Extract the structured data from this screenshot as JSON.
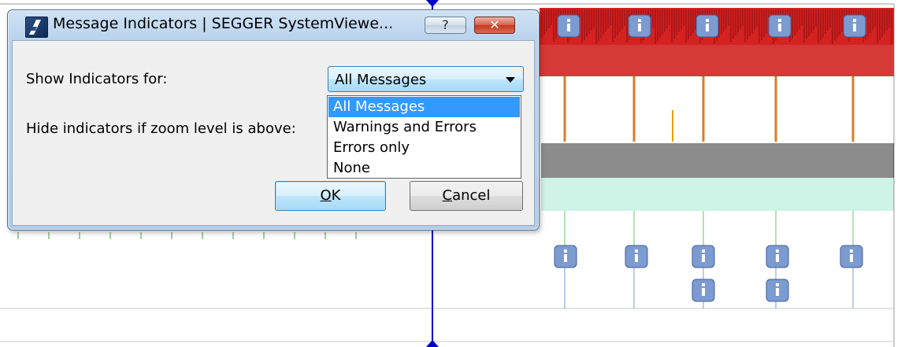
{
  "dialog": {
    "title": "Message Indicators | SEGGER SystemViewe...",
    "help_label": "?",
    "close_label": "✕",
    "show_label": "Show Indicators for:",
    "hide_label": "Hide indicators if zoom level is above:",
    "selected_value": "All Messages",
    "ok_label_mnemonic": "O",
    "ok_label_rest": "K",
    "cancel_label_mnemonic": "C",
    "cancel_label_rest": "ancel"
  },
  "dropdown": {
    "options": [
      "All Messages",
      "Warnings and Errors",
      "Errors only",
      "None"
    ]
  },
  "timeline": {
    "marker_icon": "info-icon",
    "colors": {
      "task_red": "#d42121",
      "cursor_blue": "#0000c8",
      "activity_black": "#1a1a1a",
      "activity_green": "#9ee8cf",
      "marker_blue": "#7c9bd0"
    }
  }
}
